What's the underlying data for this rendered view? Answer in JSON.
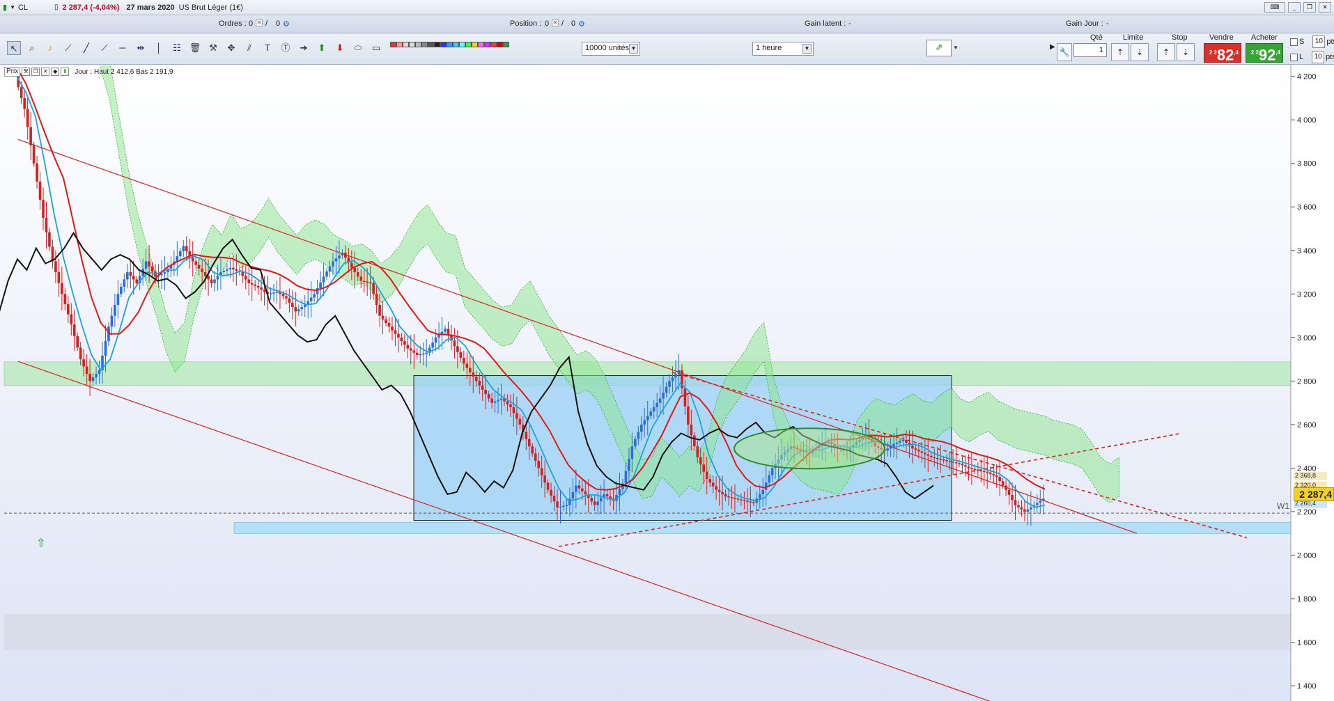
{
  "title_bar": {
    "symbol": "CL",
    "price_change": "2 287,4 (-4,04%)",
    "date": "27 mars 2020",
    "instrument": "US Brut Léger (1€)"
  },
  "info_row": {
    "orders_label": "Ordres :",
    "orders_value": "0",
    "orders_extra": "0",
    "position_label": "Position :",
    "position_value": "0",
    "position_extra": "0",
    "unrealized_label": "Gain latent :",
    "unrealized_value": "-",
    "daily_gain_label": "Gain Jour :",
    "daily_gain_value": "-"
  },
  "toolbar": {
    "units_select": "10000 unités",
    "timeframe_select": "1 heure",
    "swatch_colors": [
      "#e33",
      "#f99",
      "#fcc",
      "#ddd",
      "#bbb",
      "#888",
      "#555",
      "#222",
      "#33f",
      "#39f",
      "#3cf",
      "#6ff",
      "#3f3",
      "#fc3",
      "#f6f",
      "#c3f",
      "#f33",
      "#c00",
      "#393"
    ]
  },
  "order_panel": {
    "qty_label": "Qté",
    "qty_value": "1",
    "limit_label": "Limite",
    "stop_label": "Stop",
    "sell_label": "Vendre",
    "buy_label": "Acheter",
    "sell_prefix": "2 2",
    "sell_big": "82",
    "sell_frac": ",4",
    "buy_prefix": "2 2",
    "buy_big": "92",
    "buy_frac": ",4",
    "s_label": "S",
    "l_label": "L",
    "pts_value": "10",
    "pts_label": "pts"
  },
  "chart_legend": {
    "price_label": "Prix",
    "day_info": "Jour : Haut 2 412,6 Bas 2 191,9"
  },
  "chart_data": {
    "type": "candlestick",
    "instrument": "US Brut Léger (1€)",
    "timeframe": "1 heure",
    "y_axis_ticks": [
      "4 200",
      "4 000",
      "3 800",
      "3 600",
      "3 400",
      "3 200",
      "3 000",
      "2 800",
      "2 600",
      "2 400",
      "2 200",
      "2 000",
      "1 800",
      "1 600",
      "1 400"
    ],
    "y_range": [
      1330,
      4250
    ],
    "last_price": "2 287,4",
    "level_tags": [
      "2 368,8",
      "2 320,0",
      "2 260,4"
    ],
    "marker_label": "W1",
    "day_high": 2412.6,
    "day_low": 2191.9,
    "close_path": [
      4200,
      4050,
      3800,
      3550,
      3350,
      3200,
      3060,
      2900,
      2800,
      2850,
      3050,
      3200,
      3300,
      3250,
      3350,
      3280,
      3300,
      3350,
      3420,
      3350,
      3300,
      3250,
      3300,
      3320,
      3300,
      3250,
      3230,
      3200,
      3210,
      3180,
      3120,
      3150,
      3200,
      3280,
      3350,
      3390,
      3320,
      3260,
      3250,
      3100,
      3050,
      3000,
      2950,
      2920,
      2930,
      3000,
      3040,
      2960,
      2880,
      2820,
      2760,
      2700,
      2720,
      2680,
      2600,
      2500,
      2400,
      2300,
      2220,
      2230,
      2320,
      2280,
      2230,
      2280,
      2250,
      2330,
      2500,
      2600,
      2660,
      2720,
      2800,
      2850,
      2600,
      2450,
      2350,
      2300,
      2270,
      2260,
      2250,
      2240,
      2300,
      2400,
      2460,
      2500,
      2480,
      2470,
      2500,
      2520,
      2490,
      2480,
      2520,
      2550,
      2500,
      2480,
      2510,
      2530,
      2490,
      2470,
      2450,
      2440,
      2430,
      2420,
      2400,
      2390,
      2380,
      2360,
      2300,
      2230,
      2200,
      2230,
      2260
    ]
  }
}
